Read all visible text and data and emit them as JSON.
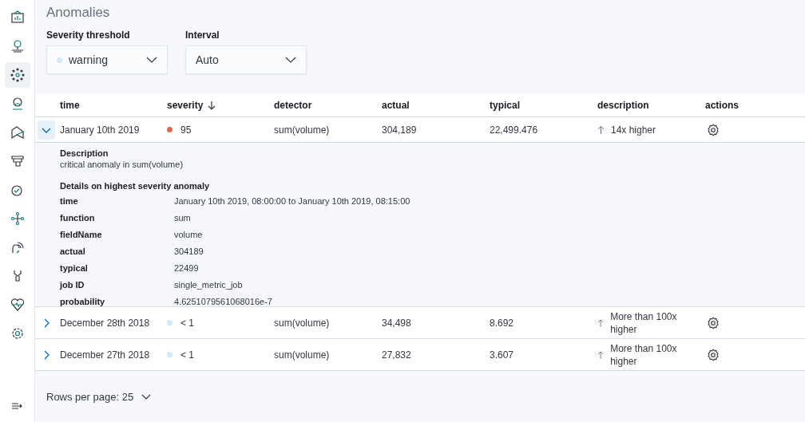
{
  "sidebar": {
    "items": [
      {
        "kind": "dashboard",
        "selected": false
      },
      {
        "kind": "pin",
        "selected": false
      },
      {
        "kind": "dots",
        "selected": true
      },
      {
        "kind": "person",
        "selected": false
      },
      {
        "kind": "map",
        "selected": false
      },
      {
        "kind": "stack",
        "selected": false
      },
      {
        "kind": "check",
        "selected": false
      },
      {
        "kind": "nodes",
        "selected": false
      },
      {
        "kind": "signal",
        "selected": false
      },
      {
        "kind": "wrench",
        "selected": false
      },
      {
        "kind": "heart",
        "selected": false
      },
      {
        "kind": "gear",
        "selected": false
      }
    ]
  },
  "title": "Anomalies",
  "filters": [
    {
      "label": "Severity threshold",
      "value": "warning",
      "color": "#d2e9f7"
    },
    {
      "label": "Interval",
      "value": "Auto"
    }
  ],
  "table": {
    "columns": [
      {
        "label": "time",
        "sorted": false
      },
      {
        "label": "severity",
        "sorted": true
      },
      {
        "label": "detector",
        "sorted": false
      },
      {
        "label": "actual",
        "sorted": false
      },
      {
        "label": "typical",
        "sorted": false
      },
      {
        "label": "description",
        "sorted": false
      },
      {
        "label": "actions",
        "sorted": false
      }
    ],
    "rows": [
      {
        "expanded": true,
        "time": "January 10th 2019",
        "color": "#e7664c",
        "severity": "95",
        "detector": "sum(volume)",
        "actual": "304,189",
        "typical": "22,499.476",
        "description": "14x higher",
        "details": {
          "description_heading": "Description",
          "description": "critical anomaly in sum(volume)",
          "details_heading": "Details on highest severity anomaly",
          "fields": [
            {
              "label": "time",
              "value": "January 10th 2019, 08:00:00 to January 10th 2019, 08:15:00"
            },
            {
              "label": "function",
              "value": "sum"
            },
            {
              "label": "fieldName",
              "value": "volume"
            },
            {
              "label": "actual",
              "value": "304189"
            },
            {
              "label": "typical",
              "value": "22499"
            },
            {
              "label": "job ID",
              "value": "single_metric_job"
            },
            {
              "label": "probability",
              "value": "4.6251079561068016e-7"
            }
          ]
        }
      },
      {
        "expanded": false,
        "time": "December 28th 2018",
        "color": "#d2e9f7",
        "severity": "< 1",
        "detector": "sum(volume)",
        "actual": "34,498",
        "typical": "8.692",
        "description": "More than 100x higher"
      },
      {
        "expanded": false,
        "time": "December 27th 2018",
        "color": "#d2e9f7",
        "severity": "< 1",
        "detector": "sum(volume)",
        "actual": "27,832",
        "typical": "3.607",
        "description": "More than 100x higher"
      }
    ]
  },
  "pagination": {
    "label": "Rows per page: 25"
  }
}
